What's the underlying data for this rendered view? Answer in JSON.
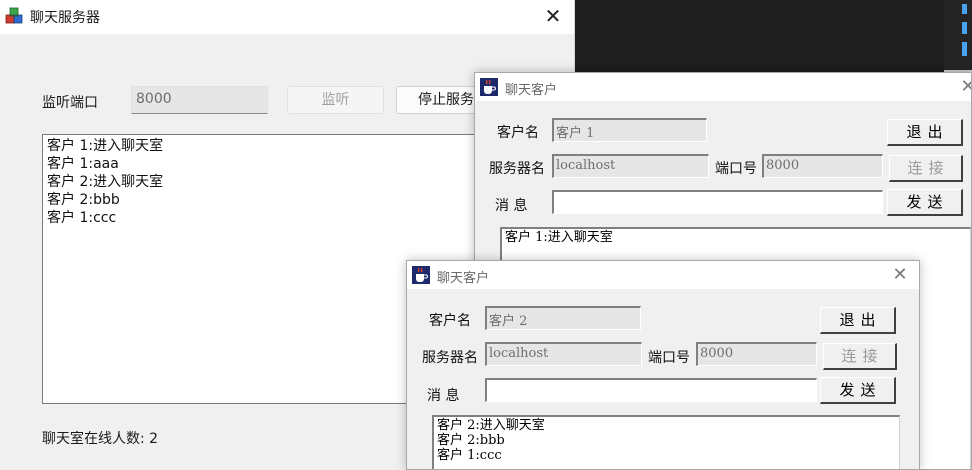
{
  "server": {
    "title": "聊天服务器",
    "close_glyph": "✕",
    "port_label": "监听端口",
    "port_value": "8000",
    "listen_button": "监听",
    "stop_button": "停止服务",
    "log_lines": [
      "客户 1:进入聊天室",
      "客户 1:aaa",
      "客户 2:进入聊天室",
      "客户 2:bbb",
      "客户 1:ccc"
    ],
    "online_label": "聊天室在线人数: 2",
    "icon": "app-cubes-icon"
  },
  "client1": {
    "title": "聊天客户",
    "close_glyph": "✕",
    "name_label": "客户名",
    "name_value": "客户 1",
    "server_label": "服务器名",
    "server_value": "localhost",
    "port_label": "端口号",
    "port_value": "8000",
    "message_label": "消 息",
    "message_value": "",
    "exit_button": "退出",
    "connect_button": "连接",
    "send_button": "发送",
    "log_lines": [
      "客户 1:进入聊天室"
    ],
    "icon": "java-cup-icon"
  },
  "client2": {
    "title": "聊天客户",
    "close_glyph": "✕",
    "name_label": "客户名",
    "name_value": "客户 2",
    "server_label": "服务器名",
    "server_value": "localhost",
    "port_label": "端口号",
    "port_value": "8000",
    "message_label": "消 息",
    "message_value": "",
    "exit_button": "退出",
    "connect_button": "连接",
    "send_button": "发送",
    "log_lines": [
      "客户 2:进入聊天室",
      "客户 2:bbb",
      "客户 1:ccc"
    ],
    "icon": "java-cup-icon"
  },
  "colors": {
    "editor_bg": "#1e1e1e",
    "editor_accent": "#4aa3f0",
    "window_bg": "#f0f0f0"
  }
}
